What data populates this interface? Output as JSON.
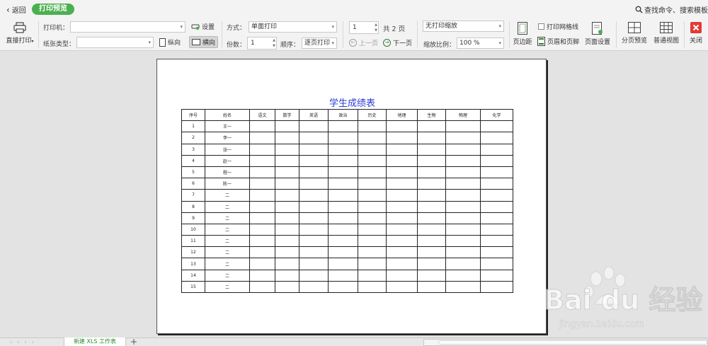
{
  "header": {
    "back_label": "返回",
    "mode_label": "打印预览",
    "search_label": "查找命令、搜索模板"
  },
  "toolbar": {
    "direct_print": "直接打印",
    "printer_label": "打印机：",
    "printer_value": "",
    "settings_label": "设置",
    "paper_type_label": "纸张类型：",
    "paper_type_value": "",
    "portrait_label": "纵向",
    "landscape_label": "横向",
    "method_label": "方式：",
    "method_value": "单面打印",
    "copies_label": "份数：",
    "copies_value": "1",
    "order_label": "顺序：",
    "order_value": "逐页打印",
    "page_number": "1",
    "total_pages": "共 2 页",
    "prev_page": "上一页",
    "next_page": "下一页",
    "scaling_value": "无打印缩放",
    "print_gridlines": "打印网格线",
    "zoom_label": "缩放比例：",
    "zoom_value": "100 %",
    "margins": "页边距",
    "header_footer": "页眉和页脚",
    "page_setup": "页面设置",
    "page_break_preview": "分页预览",
    "normal_view": "普通视图",
    "close": "关闭"
  },
  "sheet": {
    "title": "学生成绩表",
    "headers": [
      "序号",
      "姓名",
      "语文",
      "数学",
      "英语",
      "政治",
      "历史",
      "地理",
      "生物",
      "物理",
      "化学"
    ],
    "rows": [
      [
        "1",
        "王一"
      ],
      [
        "2",
        "李一"
      ],
      [
        "3",
        "张一"
      ],
      [
        "4",
        "赵一"
      ],
      [
        "5",
        "程一"
      ],
      [
        "6",
        "陈一"
      ],
      [
        "7",
        "二"
      ],
      [
        "8",
        "二"
      ],
      [
        "9",
        "二"
      ],
      [
        "10",
        "二"
      ],
      [
        "11",
        "二"
      ],
      [
        "12",
        "二"
      ],
      [
        "13",
        "二"
      ],
      [
        "14",
        "二"
      ],
      [
        "15",
        "二"
      ]
    ]
  },
  "bottom": {
    "sheet_tab": "新建 XLS 工作表",
    "add_sheet": "+"
  },
  "watermark": {
    "brand": "Bai du 经验",
    "url": "jingyan.baidu.com"
  },
  "colors": {
    "accent_green": "#4caf50",
    "title_blue": "#2b3bd6",
    "close_red": "#e53935"
  }
}
